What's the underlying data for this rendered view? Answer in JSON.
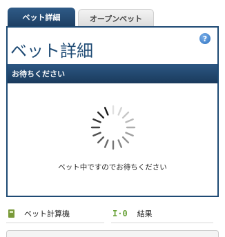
{
  "tabs": [
    {
      "label": "ベット詳細",
      "active": true
    },
    {
      "label": "オープンベット",
      "active": false
    }
  ],
  "panel": {
    "title": "ベット詳細",
    "help_icon": "?",
    "status_label": "お待ちください",
    "waiting_message": "ベット中ですのでお待ちください"
  },
  "footer": {
    "calculator_label": "ベット計算機",
    "results_label": "結果",
    "results_icon_text": "I·0"
  },
  "colors": {
    "accent": "#1e4a74",
    "icon_green": "#6aa33a"
  }
}
